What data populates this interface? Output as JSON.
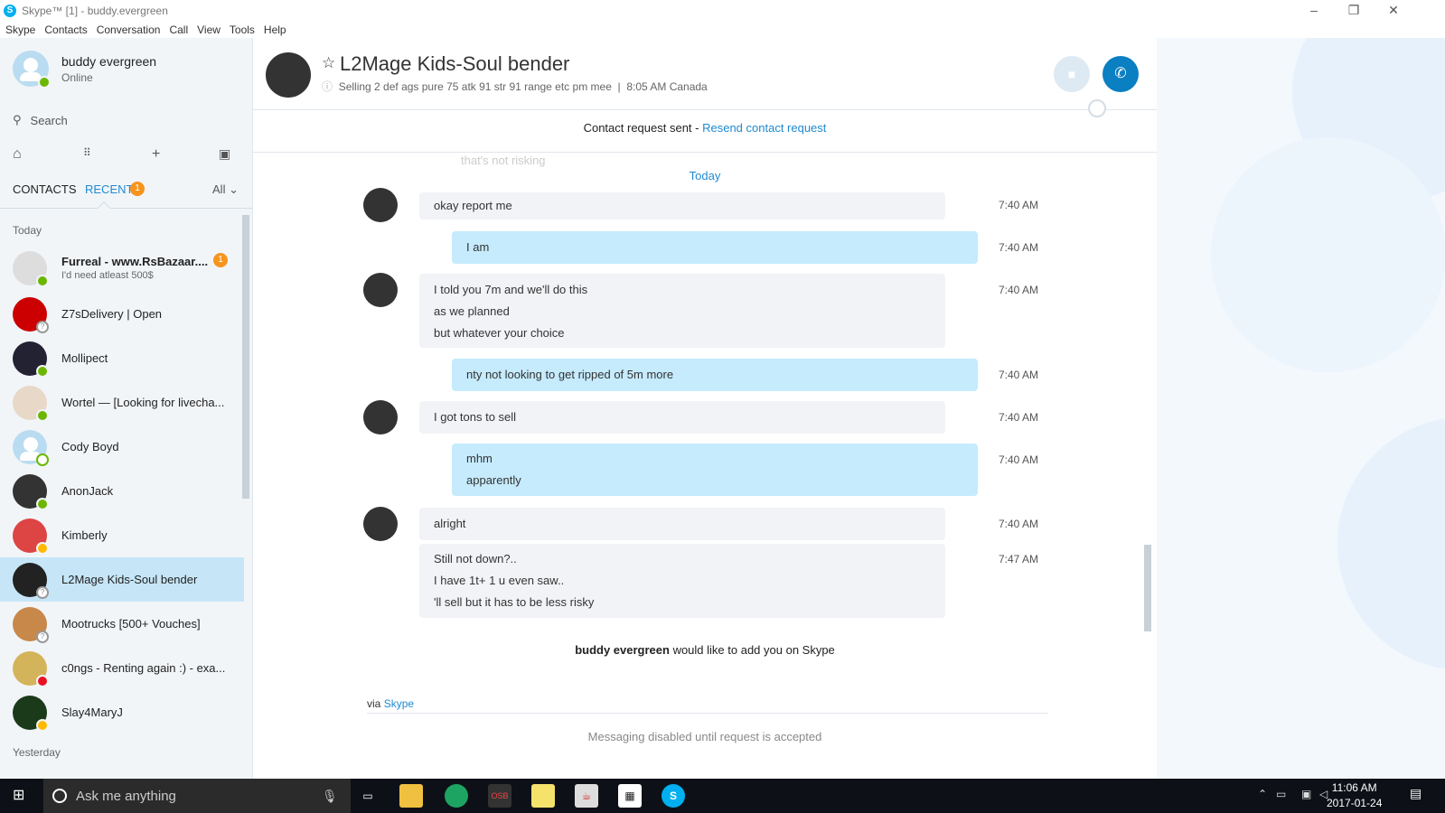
{
  "window": {
    "title": "Skype™ [1] - buddy.evergreen"
  },
  "menu": [
    "Skype",
    "Contacts",
    "Conversation",
    "Call",
    "View",
    "Tools",
    "Help"
  ],
  "profile": {
    "name": "buddy evergreen",
    "status": "Online"
  },
  "search": {
    "placeholder": "Search"
  },
  "tabs": {
    "contacts": "CONTACTS",
    "recent": "RECENT",
    "recent_badge": "1",
    "filter": "All"
  },
  "sections": {
    "today": "Today",
    "yesterday": "Yesterday"
  },
  "contacts": [
    {
      "name": "Furreal - www.RsBazaar....",
      "sub": "I'd need atleast 500$",
      "badge": "1",
      "presence": "online"
    },
    {
      "name": "Z7sDelivery | Open",
      "presence": "unknown"
    },
    {
      "name": "Mollipect",
      "presence": "online"
    },
    {
      "name": "Wortel — [Looking for livecha...",
      "presence": "online"
    },
    {
      "name": "Cody Boyd",
      "presence": "offline"
    },
    {
      "name": "AnonJack",
      "presence": "online"
    },
    {
      "name": "Kimberly",
      "presence": "away"
    },
    {
      "name": "L2Mage Kids-Soul bender",
      "presence": "unknown",
      "selected": true
    },
    {
      "name": "Mootrucks [500+ Vouches]",
      "presence": "unknown"
    },
    {
      "name": "c0ngs - Renting again :) - exa...",
      "presence": "dnd"
    },
    {
      "name": "Slay4MaryJ",
      "presence": "away"
    }
  ],
  "conversation": {
    "title": "L2Mage Kids-Soul bender",
    "mood": "Selling 2 def ags pure 75 atk 91 str 91 range etc pm mee",
    "local_time": "8:05 AM Canada",
    "contact_request_text": "Contact request sent - ",
    "resend_label": "Resend contact request",
    "day_label": "Today",
    "ghost_text": "that's not risking",
    "messages": [
      {
        "dir": "in",
        "lines": [
          "okay report me"
        ],
        "time": "7:40 AM"
      },
      {
        "dir": "out",
        "lines": [
          "I am"
        ],
        "time": "7:40 AM"
      },
      {
        "dir": "in",
        "lines": [
          "I told you 7m and we'll do this",
          "as we planned",
          "but whatever your choice"
        ],
        "time": "7:40 AM"
      },
      {
        "dir": "out",
        "lines": [
          "nty not looking to get ripped of 5m more"
        ],
        "time": "7:40 AM"
      },
      {
        "dir": "in",
        "lines": [
          "I got tons to sell"
        ],
        "time": "7:40 AM"
      },
      {
        "dir": "out",
        "lines": [
          "mhm",
          "apparently"
        ],
        "time": "7:40 AM"
      },
      {
        "dir": "in",
        "lines": [
          "alright"
        ],
        "time": "7:40 AM"
      },
      {
        "dir": "in",
        "lines": [
          "Still not down?..",
          "I have 1t+ 1 u even saw..",
          "'ll sell but it has to be less risky"
        ],
        "time": "7:47 AM"
      }
    ],
    "add_notice_name": "buddy evergreen",
    "add_notice_rest": " would like to add you on Skype",
    "via_label": "via ",
    "via_link": "Skype",
    "disabled_text": "Messaging disabled until request is accepted"
  },
  "taskbar": {
    "search_placeholder": "Ask me anything",
    "time": "11:06 AM",
    "date": "2017-01-24"
  },
  "colors": {
    "accent": "#00aff0",
    "link": "#1f8ad1",
    "call_button": "#0a7fc2",
    "outgoing_bubble": "#c5ebfd",
    "incoming_bubble": "#f1f3f6",
    "selected_contact": "#c6e6f7",
    "badge": "#f7941d"
  }
}
